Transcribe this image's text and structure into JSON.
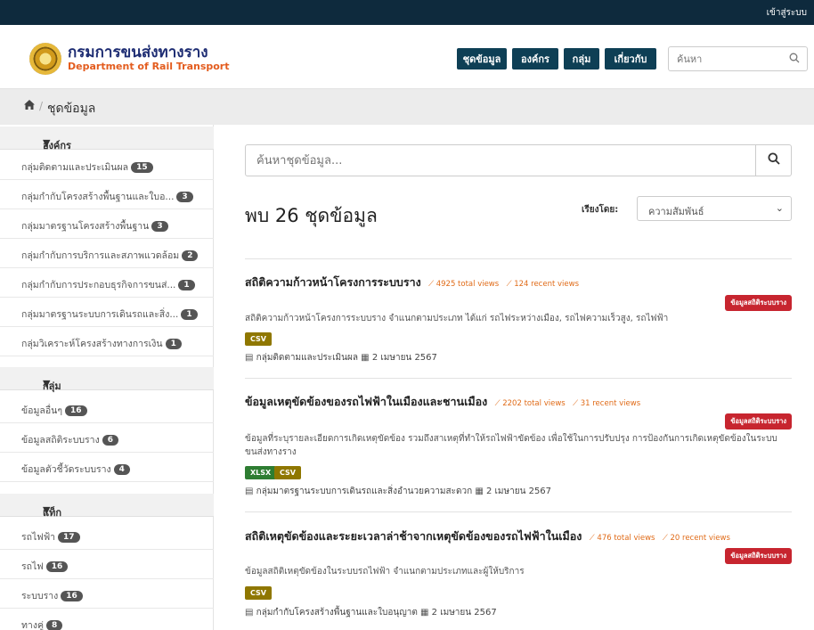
{
  "topbar": {
    "login": "เข้าสู่ระบบ"
  },
  "header": {
    "logo_th": "กรมการขนส่งทางราง",
    "logo_en": "Department of Rail Transport",
    "nav": [
      "ชุดข้อมูล",
      "องค์กร",
      "กลุ่ม",
      "เกี่ยวกับ"
    ],
    "search_placeholder": "ค้นหา"
  },
  "breadcrumb": {
    "current": "ชุดข้อมูล"
  },
  "sidebar": {
    "org_heading": "องค์กร",
    "orgs": [
      {
        "label": "กลุ่มติดตามและประเมินผล",
        "count": "15"
      },
      {
        "label": "กลุ่มกำกับโครงสร้างพื้นฐานและใบอ...",
        "count": "3"
      },
      {
        "label": "กลุ่มมาตรฐานโครงสร้างพื้นฐาน",
        "count": "3"
      },
      {
        "label": "กลุ่มกำกับการบริการและสภาพแวดล้อม",
        "count": "2"
      },
      {
        "label": "กลุ่มกำกับการประกอบธุรกิจการขนส่...",
        "count": "1"
      },
      {
        "label": "กลุ่มมาตรฐานระบบการเดินรถและสิ่ง...",
        "count": "1"
      },
      {
        "label": "กลุ่มวิเคราะห์โครงสร้างทางการเงิน",
        "count": "1"
      }
    ],
    "group_heading": "กลุ่ม",
    "groups": [
      {
        "label": "ข้อมูลอื่นๆ",
        "count": "16"
      },
      {
        "label": "ข้อมูลสถิติระบบราง",
        "count": "6"
      },
      {
        "label": "ข้อมูลตัวชี้วัดระบบราง",
        "count": "4"
      }
    ],
    "tag_heading": "แท็ก",
    "tags": [
      {
        "label": "รถไฟฟ้า",
        "count": "17"
      },
      {
        "label": "รถไฟ",
        "count": "16"
      },
      {
        "label": "ระบบราง",
        "count": "16"
      },
      {
        "label": "ทางคู่",
        "count": "8"
      }
    ]
  },
  "main": {
    "search_placeholder": "ค้นหาชุดข้อมูล...",
    "result_title": "พบ 26 ชุดข้อมูล",
    "sort_label": "เรียงโดย:",
    "sort_value": "ความสัมพันธ์",
    "datasets": [
      {
        "title": "สถิติความก้าวหน้าโครงการระบบราง",
        "total_views": "4925 total views",
        "recent_views": "124 recent views",
        "tag": "ข้อมูลสถิติระบบราง",
        "desc": "สถิติความก้าวหน้าโครงการระบบราง จำแนกตามประเภท ได้แก่ รถไฟระหว่างเมือง, รถไฟความเร็วสูง, รถไฟฟ้า",
        "formats": [
          "CSV"
        ],
        "org": "กลุ่มติดตามและประเมินผล",
        "date": "2 เมษายน 2567"
      },
      {
        "title": "ข้อมูลเหตุขัดข้องของรถไฟฟ้าในเมืองและชานเมือง",
        "total_views": "2202 total views",
        "recent_views": "31 recent views",
        "tag": "ข้อมูลสถิติระบบราง",
        "desc": "ข้อมูลที่ระบุรายละเอียดการเกิดเหตุขัดข้อง รวมถึงสาเหตุที่ทำให้รถไฟฟ้าขัดข้อง เพื่อใช้ในการปรับปรุง การป้องกันการเกิดเหตุขัดข้องในระบบขนส่งทางราง",
        "formats": [
          "XLSX",
          "CSV"
        ],
        "org": "กลุ่มมาตรฐานระบบการเดินรถและสิ่งอำนวยความสะดวก",
        "date": "2 เมษายน 2567"
      },
      {
        "title": "สถิติเหตุขัดข้องและระยะเวลาล่าช้าจากเหตุขัดข้องของรถไฟฟ้าในเมือง",
        "total_views": "476 total views",
        "recent_views": "20 recent views",
        "tag": "ข้อมูลสถิติระบบราง",
        "desc": "ข้อมูลสถิติเหตุขัดข้องในระบบรถไฟฟ้า จำแนกตามประเภทและผู้ให้บริการ",
        "formats": [
          "CSV"
        ],
        "org": "กลุ่มกำกับโครงสร้างพื้นฐานและใบอนุญาต",
        "date": "2 เมษายน 2567"
      }
    ]
  }
}
